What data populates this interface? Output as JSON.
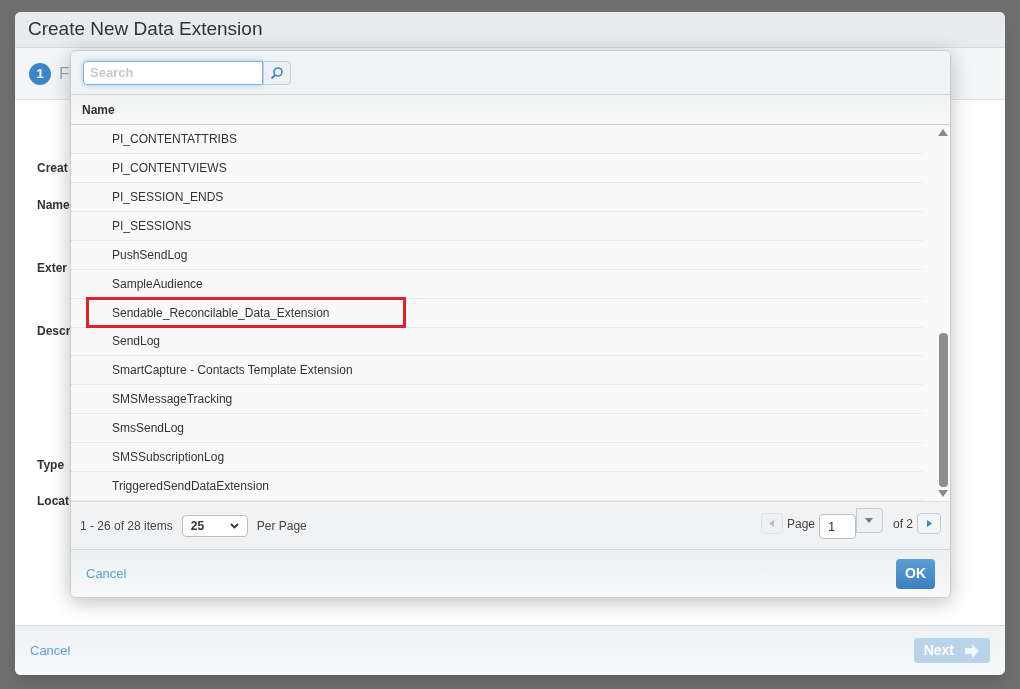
{
  "window": {
    "title": "Create New Data Extension"
  },
  "step": {
    "number": "1",
    "label": "F"
  },
  "form_labels": [
    "Creat",
    "Name",
    "Exter",
    "Descr",
    "Type",
    "Locat"
  ],
  "footer": {
    "cancel": "Cancel",
    "next": {
      "label": "Next",
      "disabled": true
    }
  },
  "picker": {
    "search": {
      "placeholder": "Search"
    },
    "column": "Name",
    "rows": [
      {
        "name": "PI_CONTENTATTRIBS",
        "highlighted": false
      },
      {
        "name": "PI_CONTENTVIEWS",
        "highlighted": false
      },
      {
        "name": "PI_SESSION_ENDS",
        "highlighted": false
      },
      {
        "name": "PI_SESSIONS",
        "highlighted": false
      },
      {
        "name": "PushSendLog",
        "highlighted": false
      },
      {
        "name": "SampleAudience",
        "highlighted": false
      },
      {
        "name": "Sendable_Reconcilable_Data_Extension",
        "highlighted": true
      },
      {
        "name": "SendLog",
        "highlighted": false
      },
      {
        "name": "SmartCapture - Contacts Template Extension",
        "highlighted": false
      },
      {
        "name": "SMSMessageTracking",
        "highlighted": false
      },
      {
        "name": "SmsSendLog",
        "highlighted": false
      },
      {
        "name": "SMSSubscriptionLog",
        "highlighted": false
      },
      {
        "name": "TriggeredSendDataExtension",
        "highlighted": false
      }
    ],
    "pager": {
      "summary": "1 - 26 of 28 items",
      "page_size": "25",
      "per_page": "Per Page",
      "prev_disabled": true,
      "next_disabled": false,
      "page_label": "Page",
      "page": "1",
      "of": "of 2"
    },
    "cancel": "Cancel",
    "ok": "OK"
  }
}
